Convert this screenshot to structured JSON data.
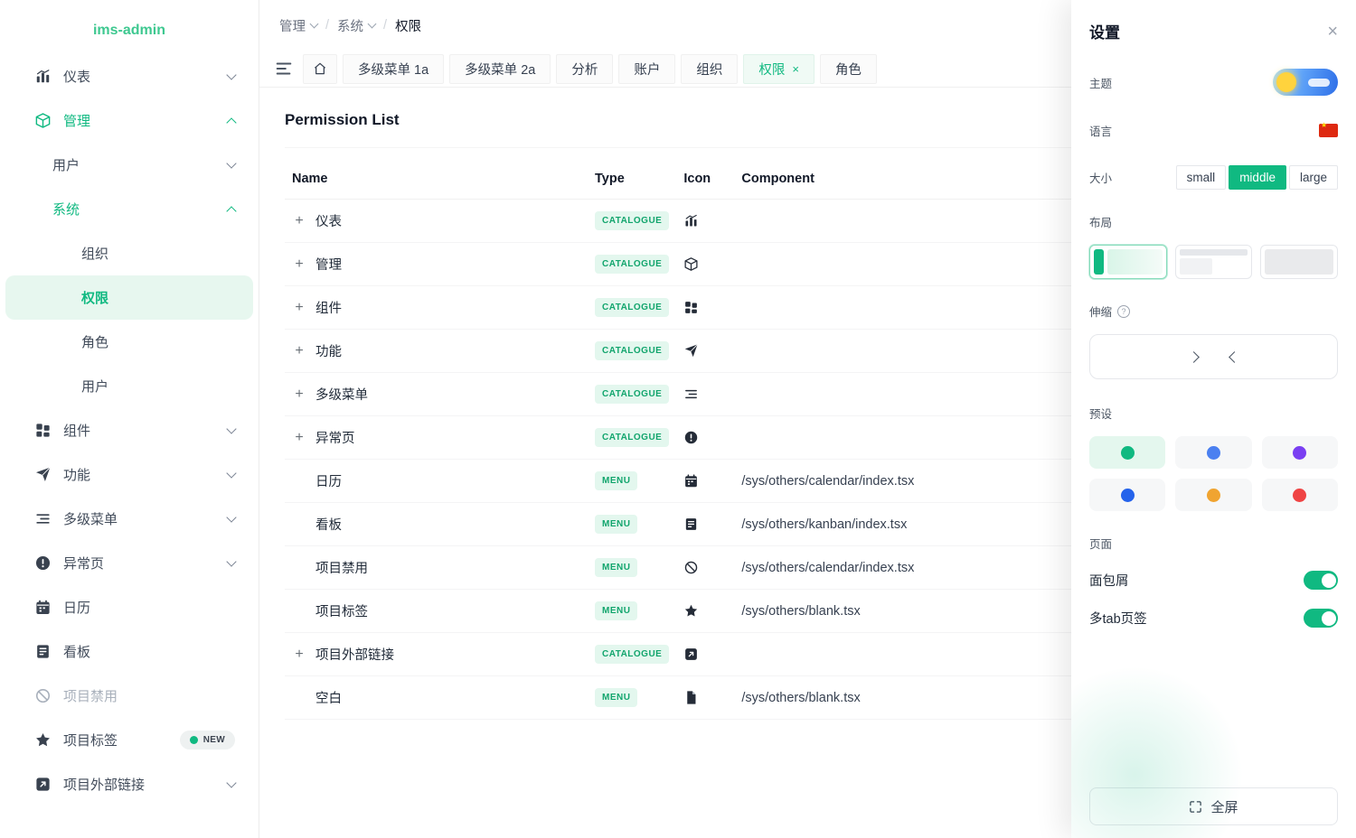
{
  "app": {
    "title": "ims-admin"
  },
  "colors": {
    "accent": "#10b981",
    "badge_bg": "#e3f7ee",
    "badge_text": "#12a56d"
  },
  "ui": {
    "plus": "+",
    "tab_close": "×",
    "separator": "/"
  },
  "sidebar": {
    "items": [
      {
        "label": "仪表",
        "icon": "chart-icon",
        "chevron": "down"
      },
      {
        "label": "管理",
        "icon": "box-icon",
        "chevron": "up",
        "active": true
      },
      {
        "label": "用户",
        "chevron": "down",
        "level": 1
      },
      {
        "label": "系统",
        "chevron": "up",
        "active": true,
        "level": 1
      },
      {
        "label": "组织",
        "level": 2
      },
      {
        "label": "权限",
        "level": 2,
        "selected": true
      },
      {
        "label": "角色",
        "level": 2
      },
      {
        "label": "用户",
        "level": 2
      },
      {
        "label": "组件",
        "icon": "grid-icon",
        "chevron": "down"
      },
      {
        "label": "功能",
        "icon": "send-icon",
        "chevron": "down"
      },
      {
        "label": "多级菜单",
        "icon": "menu-lines-icon",
        "chevron": "down"
      },
      {
        "label": "异常页",
        "icon": "warning-icon",
        "chevron": "down"
      },
      {
        "label": "日历",
        "icon": "calendar-icon"
      },
      {
        "label": "看板",
        "icon": "kanban-icon"
      },
      {
        "label": "项目禁用",
        "icon": "disabled-icon",
        "disabled": true
      },
      {
        "label": "项目标签",
        "icon": "star-icon",
        "badge": "NEW"
      },
      {
        "label": "项目外部链接",
        "icon": "external-link-icon",
        "chevron": "down"
      }
    ]
  },
  "breadcrumb": {
    "items": [
      "管理",
      "系统",
      "权限"
    ],
    "separator": "/"
  },
  "tabbar": {
    "tabs": [
      {
        "label": "多级菜单 1a"
      },
      {
        "label": "多级菜单 2a"
      },
      {
        "label": "分析"
      },
      {
        "label": "账户"
      },
      {
        "label": "组织"
      },
      {
        "label": "权限",
        "active": true,
        "closable": true
      },
      {
        "label": "角色"
      }
    ]
  },
  "page": {
    "title": "Permission List"
  },
  "table": {
    "columns": [
      "Name",
      "Type",
      "Icon",
      "Component"
    ],
    "rows": [
      {
        "name": "仪表",
        "type": "CATALOGUE",
        "icon": "chart-icon",
        "component": "",
        "expandable": true
      },
      {
        "name": "管理",
        "type": "CATALOGUE",
        "icon": "box-icon",
        "component": "",
        "expandable": true
      },
      {
        "name": "组件",
        "type": "CATALOGUE",
        "icon": "grid-icon",
        "component": "",
        "expandable": true
      },
      {
        "name": "功能",
        "type": "CATALOGUE",
        "icon": "send-icon",
        "component": "",
        "expandable": true
      },
      {
        "name": "多级菜单",
        "type": "CATALOGUE",
        "icon": "menu-lines-icon",
        "component": "",
        "expandable": true
      },
      {
        "name": "异常页",
        "type": "CATALOGUE",
        "icon": "warning-icon",
        "component": "",
        "expandable": true
      },
      {
        "name": "日历",
        "type": "MENU",
        "icon": "calendar-icon",
        "component": "/sys/others/calendar/index.tsx",
        "expandable": false
      },
      {
        "name": "看板",
        "type": "MENU",
        "icon": "kanban-icon",
        "component": "/sys/others/kanban/index.tsx",
        "expandable": false
      },
      {
        "name": "项目禁用",
        "type": "MENU",
        "icon": "disabled-icon",
        "component": "/sys/others/calendar/index.tsx",
        "expandable": false
      },
      {
        "name": "项目标签",
        "type": "MENU",
        "icon": "star-icon",
        "component": "/sys/others/blank.tsx",
        "expandable": false
      },
      {
        "name": "项目外部链接",
        "type": "CATALOGUE",
        "icon": "external-link-icon",
        "component": "",
        "expandable": true
      },
      {
        "name": "空白",
        "type": "MENU",
        "icon": "blank-icon",
        "component": "/sys/others/blank.tsx",
        "expandable": false
      }
    ]
  },
  "settings": {
    "title": "设置",
    "close_glyph": "×",
    "theme_label": "主题",
    "theme_mode": "light",
    "language_label": "语言",
    "language_value": "zh-CN",
    "size_label": "大小",
    "size_options": [
      "small",
      "middle",
      "large"
    ],
    "size_selected": "middle",
    "layout_label": "布局",
    "layout_selected_index": 0,
    "stretch_label": "伸缩",
    "stretch_help_glyph": "?",
    "presets_label": "预设",
    "preset_colors": [
      "#10b981",
      "#4b80f0",
      "#7a3ff2",
      "#2563eb",
      "#f0a431",
      "#ef4444"
    ],
    "preset_selected_index": 0,
    "page_label": "页面",
    "breadcrumb_label": "面包屑",
    "breadcrumb_enabled": true,
    "multitab_label": "多tab页签",
    "multitab_enabled": true,
    "fullscreen_label": "全屏"
  }
}
